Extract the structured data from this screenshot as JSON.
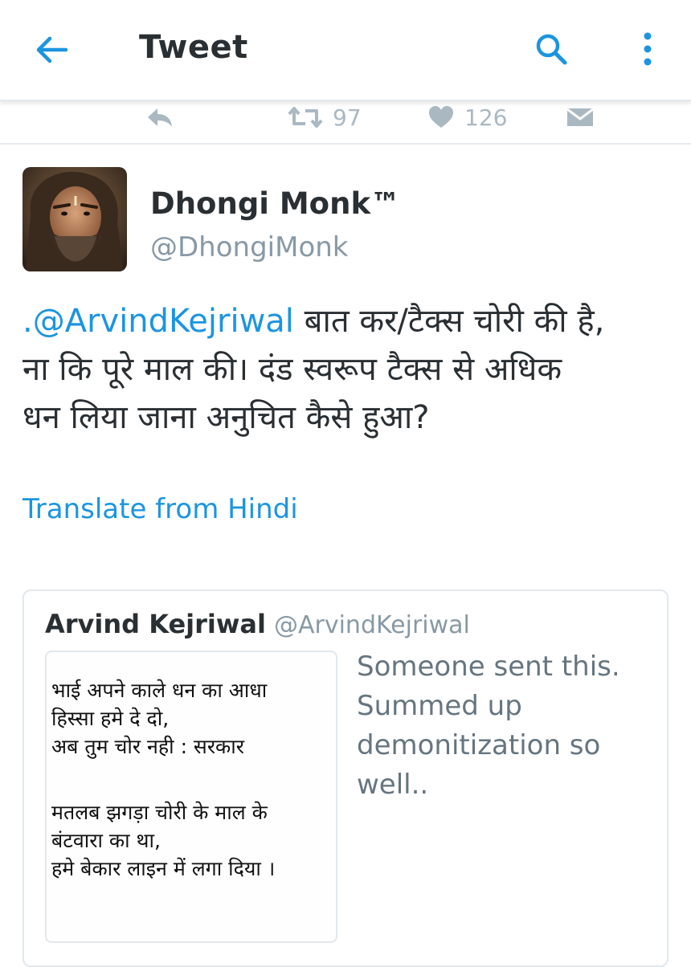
{
  "topbar": {
    "back_icon": "arrow-left-icon",
    "title": "Tweet",
    "search_icon": "search-icon",
    "menu_icon": "more-vertical-icon"
  },
  "actions": {
    "reply_icon": "reply-icon",
    "retweet_icon": "retweet-icon",
    "retweet_count": "97",
    "like_icon": "heart-icon",
    "like_count": "126",
    "dm_icon": "direct-message-icon"
  },
  "tweet": {
    "author_name": "Dhongi Monk™",
    "author_handle": "@DhongiMonk",
    "text_lines": [
      {
        "mention": ".@ArvindKejriwal",
        "rest": " बात कर/टैक्स चोरी की है,"
      },
      {
        "mention": "",
        "rest": "ना कि पूरे माल की। दंड स्वरूप टैक्स से अधिक"
      },
      {
        "mention": "",
        "rest": "धन लिया जाना अनुचित कैसे हुआ?"
      }
    ],
    "translate_label": "Translate from Hindi"
  },
  "quote": {
    "author_name": "Arvind Kejriwal",
    "author_handle": "@ArvindKejriwal",
    "image_text": {
      "stanza1": [
        "भाई अपने काले धन का आधा",
        "हिस्सा हमे दे दो,",
        "अब तुम चोर नही : सरकार"
      ],
      "stanza2": [
        "मतलब झगड़ा चोरी के माल के",
        "बंटवारा का था,",
        "हमे बेकार लाइन में लगा दिया ।"
      ]
    },
    "text": "Someone sent this. Summed up demonitization so well.."
  },
  "colors": {
    "accent": "#1b95e0",
    "text_primary": "#292f33",
    "text_secondary": "#8899a6",
    "action_gray": "#aab8c2",
    "border": "#e1e8ed"
  }
}
